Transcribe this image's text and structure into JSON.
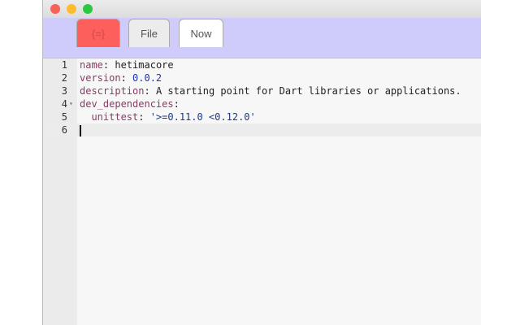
{
  "tabs": [
    {
      "label": "{=}",
      "color": "#fd5f5c"
    },
    {
      "label": "File"
    },
    {
      "label": "Now"
    }
  ],
  "editor": {
    "lines": [
      {
        "n": "1",
        "key": "name",
        "rest": " hetimacore",
        "kind": "plain"
      },
      {
        "n": "2",
        "key": "version",
        "rest": " 0.0.2",
        "kind": "num"
      },
      {
        "n": "3",
        "key": "description",
        "rest": " A starting point for Dart libraries or applications.",
        "kind": "plain"
      },
      {
        "n": "4",
        "key": "dev_dependencies",
        "rest": "",
        "kind": "plain",
        "fold": "▾"
      },
      {
        "n": "5",
        "key": "  unittest",
        "rest": " '>=0.11.0 <0.12.0'",
        "kind": "str"
      },
      {
        "n": "6",
        "key": "",
        "rest": "",
        "kind": "plain"
      }
    ]
  }
}
